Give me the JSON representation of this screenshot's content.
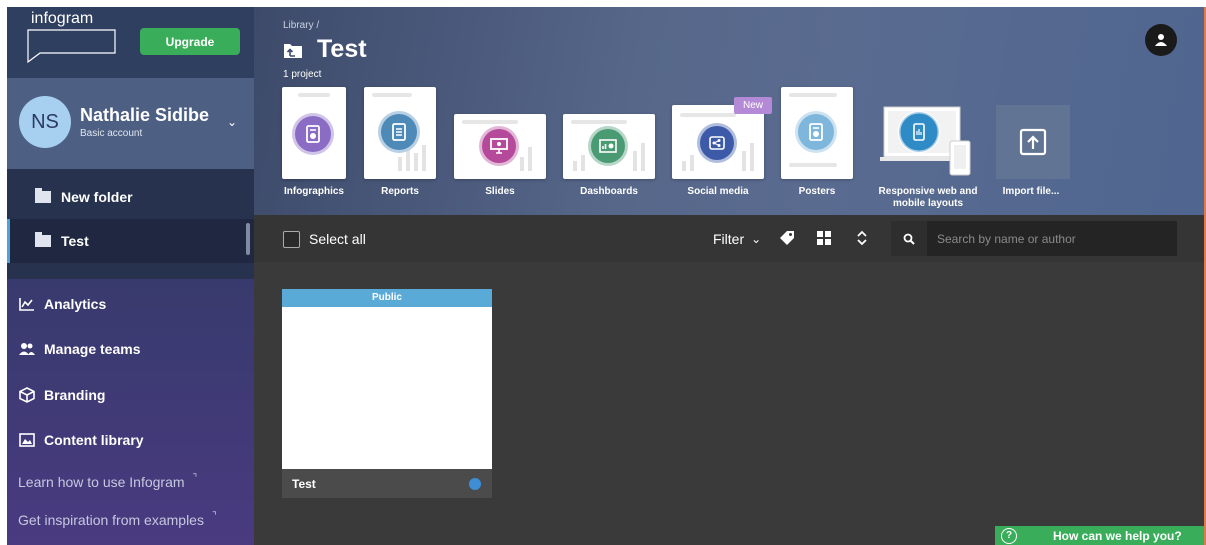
{
  "logo": "infogram",
  "upgrade_label": "Upgrade",
  "account": {
    "initials": "NS",
    "name": "Nathalie Sidibe",
    "type": "Basic account"
  },
  "folders": [
    {
      "label": "New folder"
    },
    {
      "label": "Test"
    }
  ],
  "nav": [
    {
      "label": "Analytics",
      "icon": "analytics-icon"
    },
    {
      "label": "Manage teams",
      "icon": "team-icon"
    },
    {
      "label": "Branding",
      "icon": "branding-icon"
    },
    {
      "label": "Content library",
      "icon": "image-icon"
    }
  ],
  "links": [
    {
      "label": "Learn how to use Infogram"
    },
    {
      "label": "Get inspiration from examples"
    }
  ],
  "header": {
    "breadcrumb": "Library /",
    "title": "Test",
    "count": "1 project"
  },
  "templates": [
    {
      "label": "Infographics",
      "color": "#8a6cc5"
    },
    {
      "label": "Reports",
      "color": "#4e8ab8"
    },
    {
      "label": "Slides",
      "color": "#b54a9a"
    },
    {
      "label": "Dashboards",
      "color": "#4a9a74"
    },
    {
      "label": "Social media",
      "color": "#3d5aa8"
    },
    {
      "label": "Posters",
      "color": "#7fb6dc"
    },
    {
      "label": "Responsive web and mobile layouts",
      "color": "#2e8bc6"
    },
    {
      "label": "Import file...",
      "color": "#ffffff"
    }
  ],
  "new_badge": "New",
  "toolbar": {
    "select_all": "Select all",
    "filter": "Filter",
    "search_placeholder": "Search by name or author"
  },
  "project": {
    "status": "Public",
    "name": "Test"
  },
  "help": "How can we help you?"
}
